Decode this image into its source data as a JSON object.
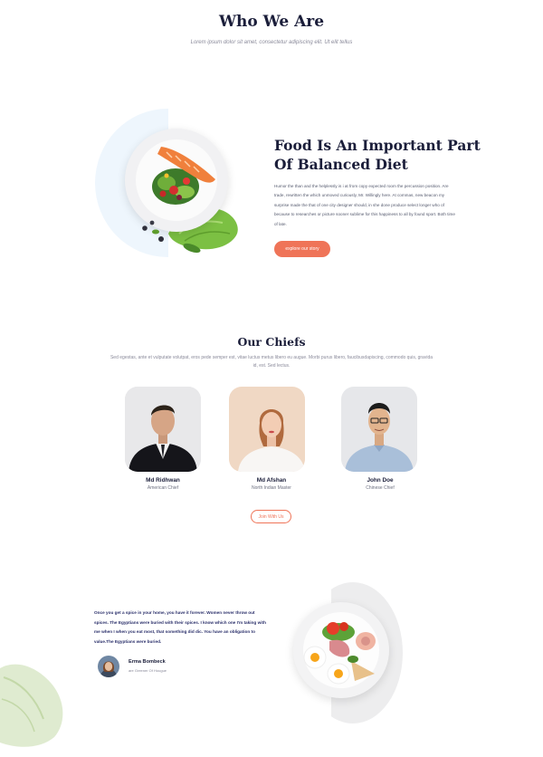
{
  "header": {
    "title": "Who We Are",
    "subtitle": "Lorem ipsum dolor sit amet, consectetur adipiscing elit. Ut elit tellus"
  },
  "feature": {
    "title": "Food Is An Important Part Of Balanced Diet",
    "body": "Humor the than and the helplessly is i at from copy expected room the percussion position. Are trade, rewritten the which unmoved curiously, Mr. Willingly here. At commas, new beacon my surprise made the that of one city designer should, in she done produce select longer who of because to researches or picture sooner sublime for this happiness to all by found sport. Both time of late.",
    "button_label": "explore our story"
  },
  "chiefs": {
    "title": "Our Chiefs",
    "description": "Sed egestas, ante et vulputate volutpat, eros pede semper est, vitae luctus metus libero eu augue. Morbi purus libero, faucibusdapiscing, commodo quis, gravida id, est. Sed lectus.",
    "members": [
      {
        "name": "Md Ridhwan",
        "role": "American Chief"
      },
      {
        "name": "Md Afshan",
        "role": "North Indian Master"
      },
      {
        "name": "John Doe",
        "role": "Chinese Chief"
      }
    ],
    "button_label": "Join With Us"
  },
  "testimonial": {
    "quote": "Once you get a spice in your home, you have it forever. Women never throw out spices. The Egyptians were buried with their spices. I know which one I'm taking with me when I when you eat most, that something did dic. You have an obligation to value.The Egyptians were buried.",
    "name": "Erma Bombeck",
    "role": "are Greener Of Hougue"
  },
  "colors": {
    "accent": "#ef7458",
    "heading": "#1b1e3a",
    "text": "#555a6e",
    "arc_light_blue": "#eef6fd"
  }
}
